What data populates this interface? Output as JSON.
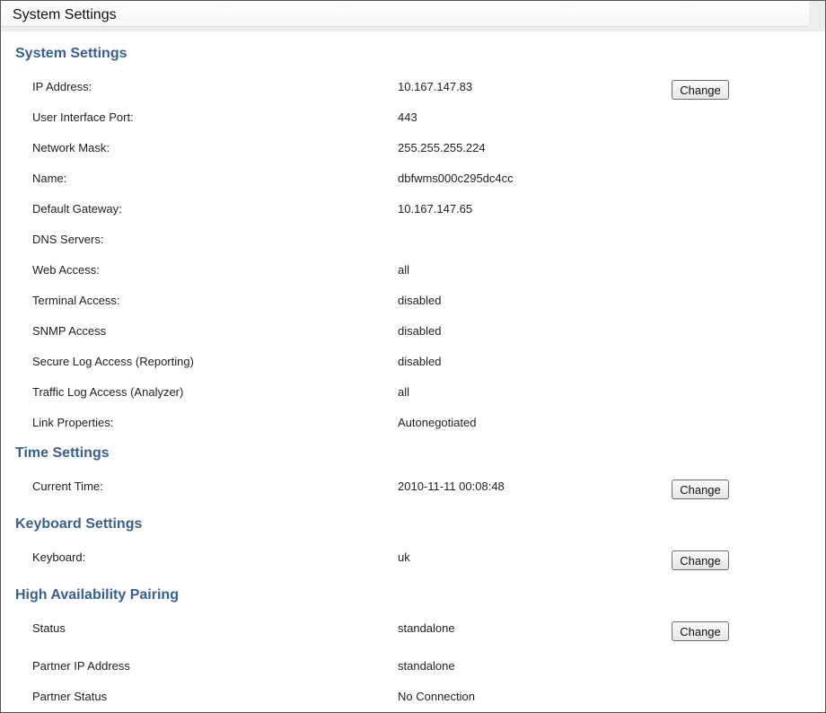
{
  "window": {
    "title": "System Settings"
  },
  "sections": {
    "system": {
      "heading": "System Settings",
      "rows": [
        {
          "label": "IP Address:",
          "value": "10.167.147.83",
          "button": "Change"
        },
        {
          "label": "User Interface Port:",
          "value": "443"
        },
        {
          "label": "Network Mask:",
          "value": "255.255.255.224"
        },
        {
          "label": "Name:",
          "value": "dbfwms000c295dc4cc"
        },
        {
          "label": "Default Gateway:",
          "value": "10.167.147.65"
        },
        {
          "label": "DNS Servers:",
          "value": ""
        },
        {
          "label": "Web Access:",
          "value": "all"
        },
        {
          "label": "Terminal Access:",
          "value": "disabled"
        },
        {
          "label": "SNMP Access",
          "value": "disabled"
        },
        {
          "label": "Secure Log Access (Reporting)",
          "value": "disabled"
        },
        {
          "label": "Traffic Log Access (Analyzer)",
          "value": "all"
        },
        {
          "label": "Link Properties:",
          "value": "Autonegotiated"
        }
      ]
    },
    "time": {
      "heading": "Time Settings",
      "rows": [
        {
          "label": "Current Time:",
          "value": "2010-11-11 00:08:48",
          "button": "Change"
        }
      ]
    },
    "keyboard": {
      "heading": "Keyboard Settings",
      "rows": [
        {
          "label": "Keyboard:",
          "value": "uk",
          "button": "Change"
        }
      ]
    },
    "ha": {
      "heading": "High Availability Pairing",
      "rows": [
        {
          "label": "Status",
          "value": "standalone",
          "button": "Change"
        },
        {
          "label": "Partner IP Address",
          "value": "standalone"
        },
        {
          "label": "Partner Status",
          "value": "No Connection"
        }
      ]
    }
  },
  "colors": {
    "heading": "#3a5f8f",
    "text": "#222222",
    "titlebar_bg": "#ededed",
    "border": "#555555"
  }
}
